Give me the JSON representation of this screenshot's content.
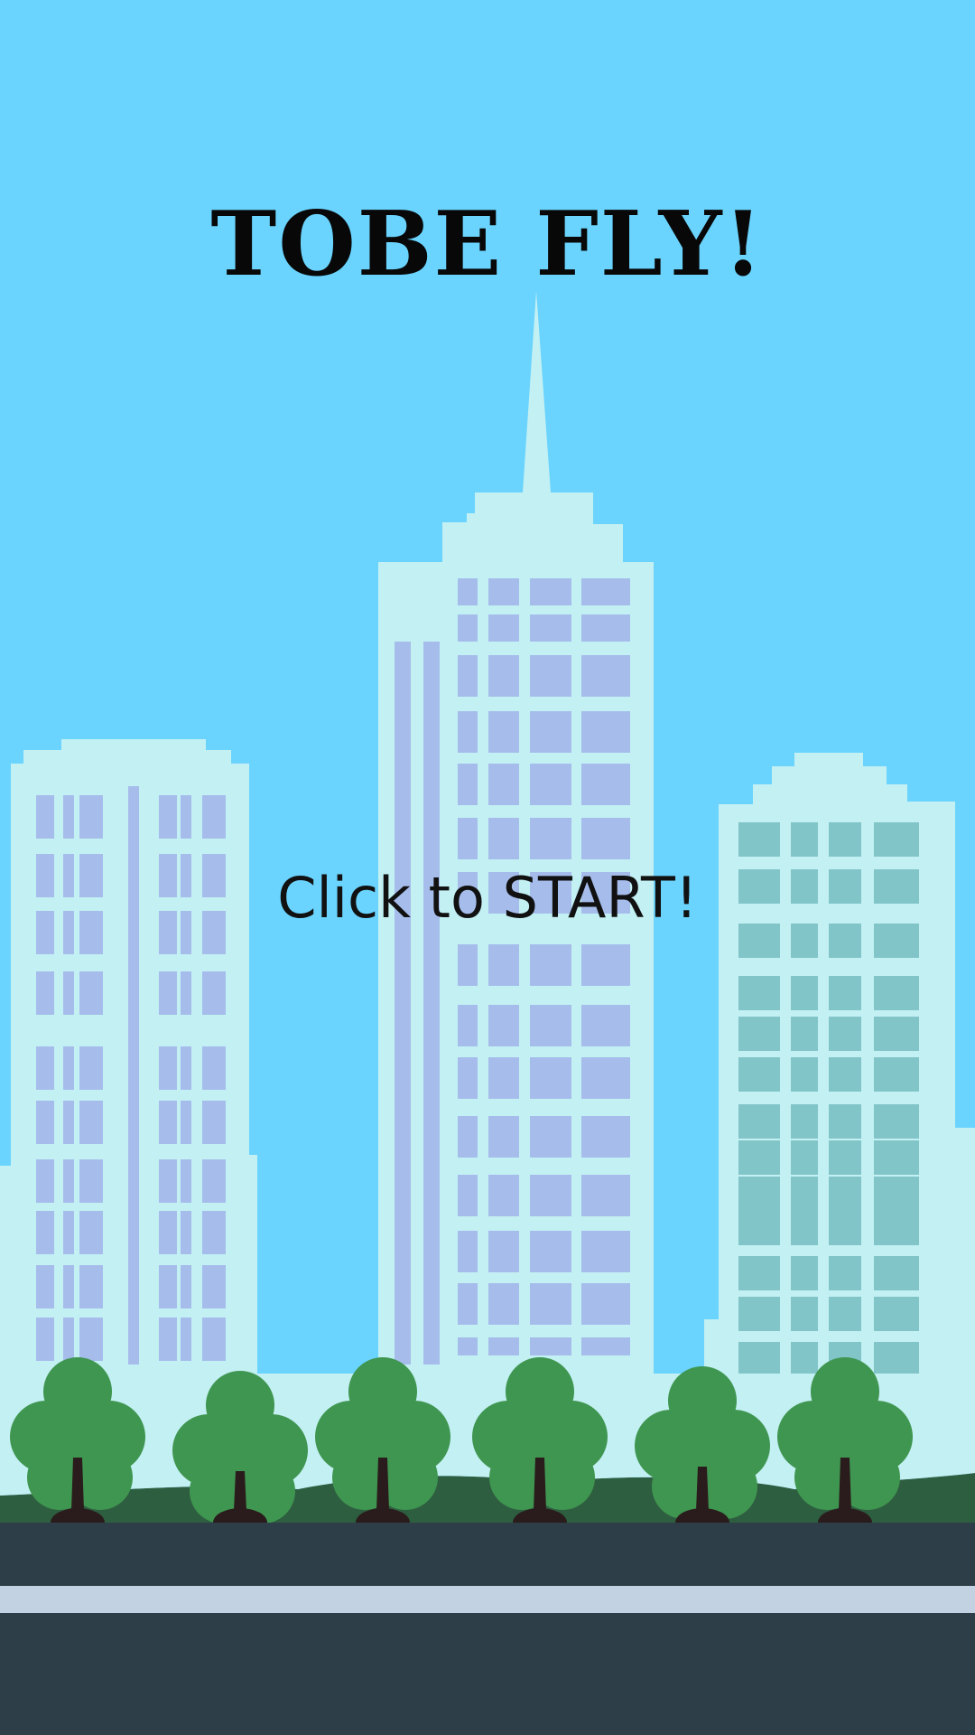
{
  "game": {
    "title": "TOBE FLY!",
    "start_prompt": "Click to START!"
  },
  "colors": {
    "sky": "#6ad4fe",
    "building": "#c3f0f3",
    "window_blue": "#a6bdec",
    "window_teal": "#82c5c9",
    "tree_foliage": "#3f9650",
    "tree_trunk": "#2a1c1c",
    "hill": "#2e5e40",
    "road": "#2d3e48",
    "road_stripe": "#c3d2e3"
  }
}
